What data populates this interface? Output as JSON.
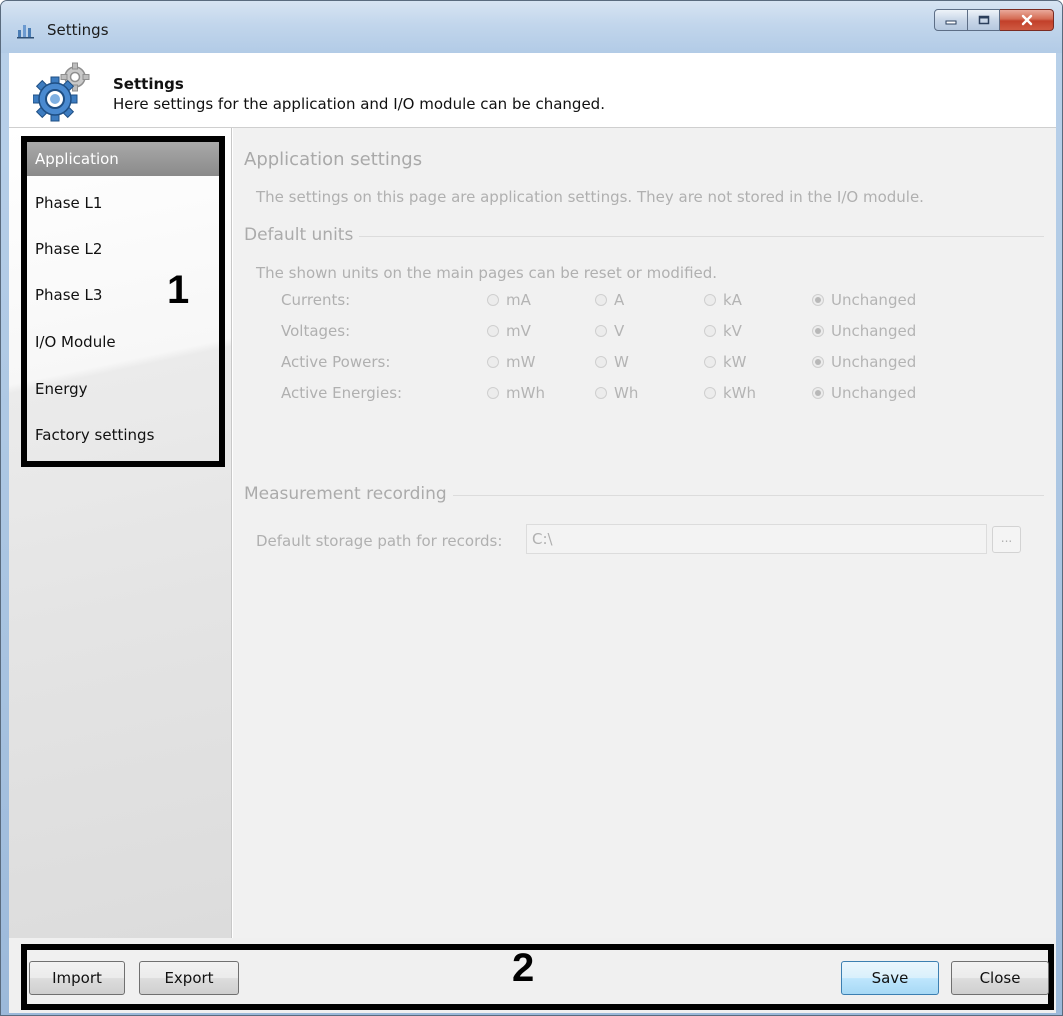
{
  "window": {
    "title": "Settings",
    "icon": "settings-app-icon",
    "controls": {
      "minimize": "minimize-icon",
      "maximize": "maximize-icon",
      "close": "close-icon"
    }
  },
  "header": {
    "title": "Settings",
    "subtitle": "Here settings for the application and I/O module can be changed.",
    "icon": "gears-icon"
  },
  "sidebar": {
    "items": [
      {
        "label": "Application",
        "selected": true
      },
      {
        "label": "Phase L1",
        "selected": false
      },
      {
        "label": "Phase L2",
        "selected": false
      },
      {
        "label": "Phase L3",
        "selected": false
      },
      {
        "label": "I/O Module",
        "selected": false
      },
      {
        "label": "Energy",
        "selected": false
      },
      {
        "label": "Factory settings",
        "selected": false
      }
    ],
    "marker": "1"
  },
  "content": {
    "title": "Application settings",
    "description": "The settings on this page are application settings. They are not stored in the I/O module.",
    "default_units": {
      "title": "Default units",
      "description": "The shown units on the main pages can be reset or modified.",
      "rows": [
        {
          "label": "Currents:",
          "options": [
            "mA",
            "A",
            "kA",
            "Unchanged"
          ],
          "selected": "Unchanged"
        },
        {
          "label": "Voltages:",
          "options": [
            "mV",
            "V",
            "kV",
            "Unchanged"
          ],
          "selected": "Unchanged"
        },
        {
          "label": "Active Powers:",
          "options": [
            "mW",
            "W",
            "kW",
            "Unchanged"
          ],
          "selected": "Unchanged"
        },
        {
          "label": "Active Energies:",
          "options": [
            "mWh",
            "Wh",
            "kWh",
            "Unchanged"
          ],
          "selected": "Unchanged"
        }
      ]
    },
    "measurement": {
      "title": "Measurement recording",
      "path_label": "Default storage path for records:",
      "path_value": "C:\\",
      "browse_label": "..."
    }
  },
  "footer": {
    "import_label": "Import",
    "export_label": "Export",
    "save_label": "Save",
    "close_label": "Close",
    "marker": "2"
  }
}
